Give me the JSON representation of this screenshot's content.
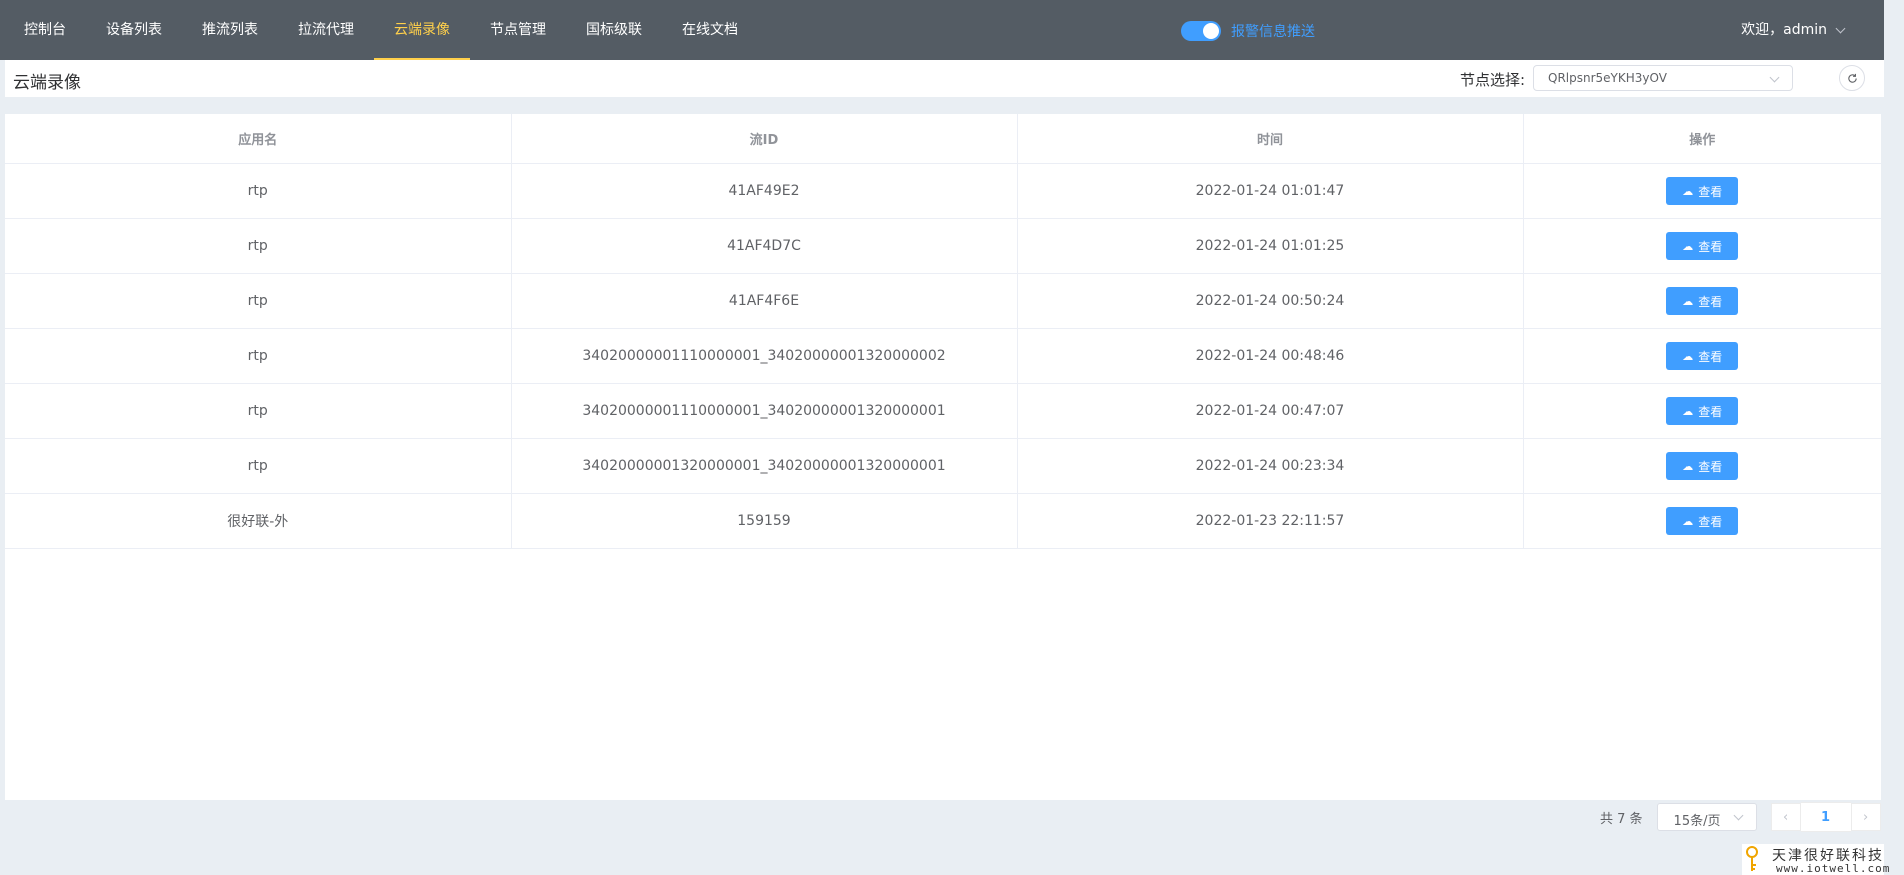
{
  "nav": {
    "items": [
      {
        "label": "控制台"
      },
      {
        "label": "设备列表"
      },
      {
        "label": "推流列表"
      },
      {
        "label": "拉流代理"
      },
      {
        "label": "云端录像"
      },
      {
        "label": "节点管理"
      },
      {
        "label": "国标级联"
      },
      {
        "label": "在线文档"
      }
    ],
    "active": "云端录像",
    "alarm_label": "报警信息推送",
    "alarm_on": true,
    "user": "欢迎，admin"
  },
  "header": {
    "title": "云端录像",
    "node_label": "节点选择:",
    "node_value": "QRlpsnr5eYKH3yOV",
    "refresh_icon": "refresh-icon"
  },
  "table": {
    "columns": [
      "应用名",
      "流ID",
      "时间",
      "操作"
    ],
    "view_label": "查看",
    "rows": [
      {
        "app": "rtp",
        "stream": "41AF49E2",
        "time": "2022-01-24 01:01:47"
      },
      {
        "app": "rtp",
        "stream": "41AF4D7C",
        "time": "2022-01-24 01:01:25"
      },
      {
        "app": "rtp",
        "stream": "41AF4F6E",
        "time": "2022-01-24 00:50:24"
      },
      {
        "app": "rtp",
        "stream": "34020000001110000001_34020000001320000002",
        "time": "2022-01-24 00:48:46"
      },
      {
        "app": "rtp",
        "stream": "34020000001110000001_34020000001320000001",
        "time": "2022-01-24 00:47:07"
      },
      {
        "app": "rtp",
        "stream": "34020000001320000001_34020000001320000001",
        "time": "2022-01-24 00:23:34"
      },
      {
        "app": "很好联-外",
        "stream": "159159",
        "time": "2022-01-23 22:11:57"
      }
    ]
  },
  "pagination": {
    "total": "共 7 条",
    "page_size": "15条/页",
    "current": "1"
  },
  "watermark": {
    "cn": "天津很好联科技",
    "url": "www.iotwell.com"
  },
  "colors": {
    "nav_bg": "#545c64",
    "active": "#ffd04b",
    "primary": "#409eff"
  }
}
